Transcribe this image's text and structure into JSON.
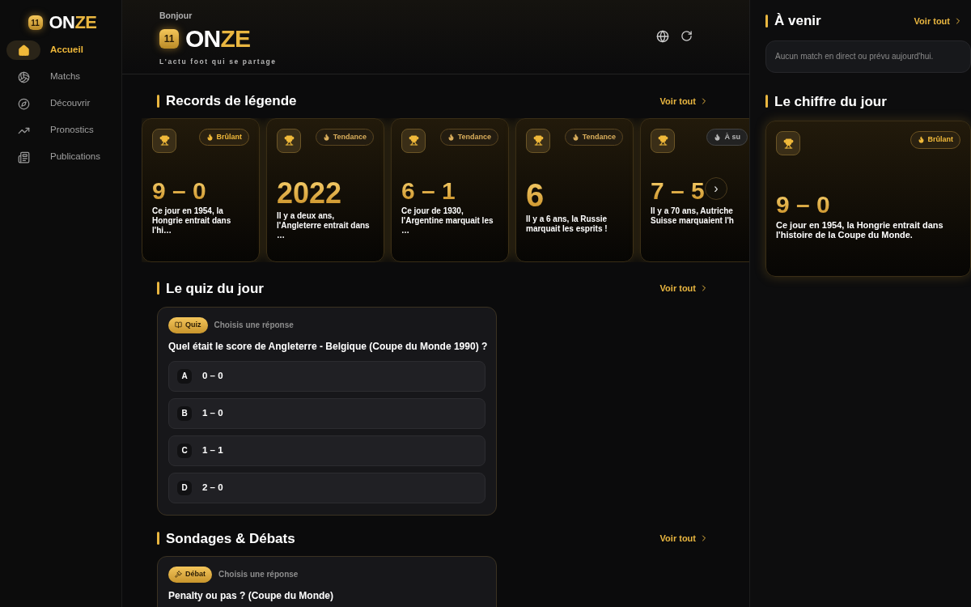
{
  "sidebar": {
    "logo": {
      "badge": "11",
      "word_start": "ON",
      "word_end": "ZE"
    },
    "items": [
      {
        "label": "Accueil",
        "selected": true
      },
      {
        "label": "Matchs",
        "selected": false
      },
      {
        "label": "Découvrir",
        "selected": false
      },
      {
        "label": "Pronostics",
        "selected": false
      },
      {
        "label": "Publications",
        "selected": false
      }
    ]
  },
  "header": {
    "greeting": "Bonjour",
    "logo": {
      "badge": "11",
      "word_start": "ON",
      "word_end": "ZE"
    },
    "tagline": "L'actu foot qui se partage"
  },
  "records": {
    "title": "Records de légende",
    "link": "Voir tout",
    "next": "›",
    "cards": [
      {
        "badge": "Brûlant",
        "kind": "hot",
        "figure": "9 – 0",
        "text": "Ce jour en 1954, la Hongrie entrait dans l'hi…"
      },
      {
        "badge": "Tendance",
        "kind": "trend",
        "figure": "2022",
        "text": "Il y a deux ans, l'Angleterre entrait dans …"
      },
      {
        "badge": "Tendance",
        "kind": "trend",
        "figure": "6 – 1",
        "text": "Ce jour de 1930, l'Argentine marquait les …"
      },
      {
        "badge": "Tendance",
        "kind": "trend",
        "figure": "6",
        "text": "Il y a 6 ans, la Russie marquait les esprits !"
      },
      {
        "badge": "À su",
        "kind": "follow",
        "figure": "7 – 5",
        "text": "Il y a 70 ans, Autriche Suisse marquaient l'h"
      }
    ]
  },
  "quiz": {
    "title": "Le quiz du jour",
    "link": "Voir tout",
    "tag": "Quiz",
    "hint": "Choisis une réponse",
    "question": "Quel était le score de Angleterre - Belgique (Coupe du Monde 1990) ?",
    "options": [
      {
        "letter": "A",
        "answer": "0 – 0"
      },
      {
        "letter": "B",
        "answer": "1 – 0"
      },
      {
        "letter": "C",
        "answer": "1 – 1"
      },
      {
        "letter": "D",
        "answer": "2 – 0"
      }
    ]
  },
  "debates": {
    "title": "Sondages & Débats",
    "link": "Voir tout",
    "tag": "Débat",
    "hint": "Choisis une réponse",
    "question": "Penalty ou pas ? (Coupe du Monde)"
  },
  "upcoming": {
    "title": "À venir",
    "link": "Voir tout",
    "empty": "Aucun match en direct ou prévu aujourd'hui."
  },
  "number_of_day": {
    "title": "Le chiffre du jour",
    "badge": "Brûlant",
    "kind": "hot",
    "figure": "9 – 0",
    "text": "Ce jour en 1954, la Hongrie entrait dans l'histoire de la Coupe du Monde."
  }
}
